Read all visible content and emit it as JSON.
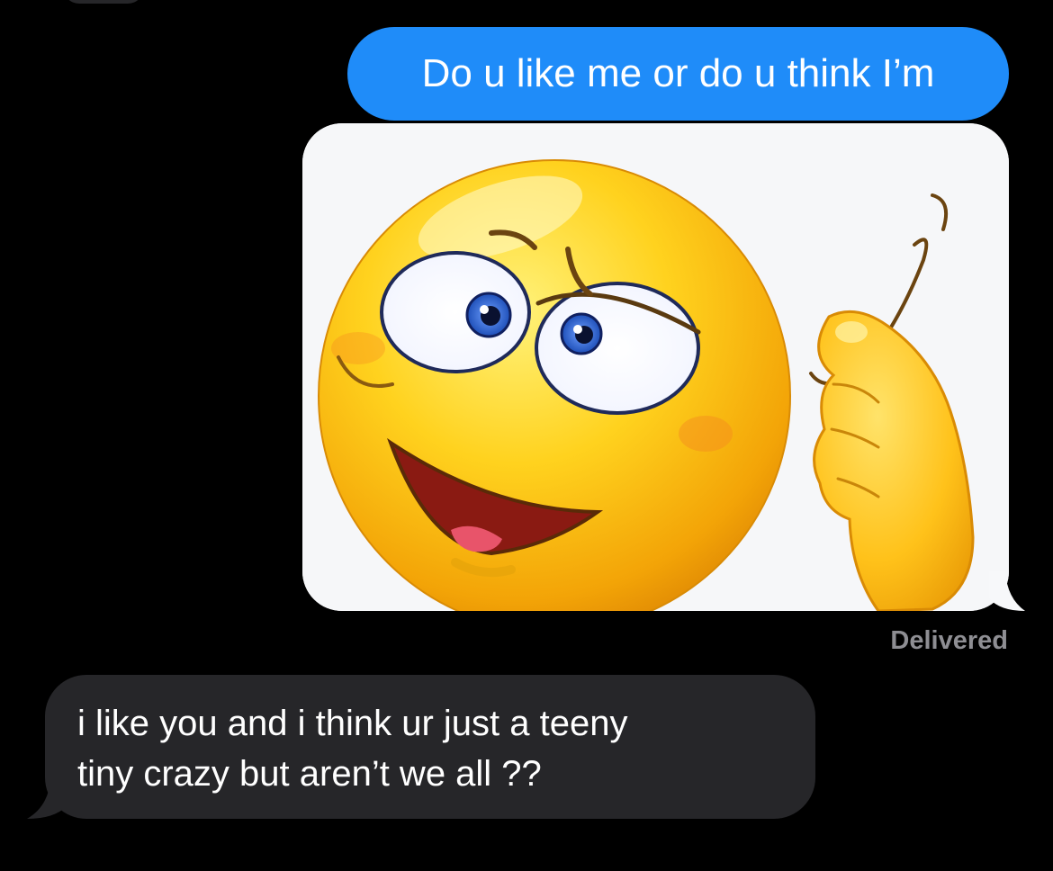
{
  "conversation": {
    "outgoing_text": "Do u like me or do u think I’m",
    "attachment_icon": "crazy-face-emoji-icon",
    "delivery_status": "Delivered",
    "incoming_text_line1": "i like you and i think ur just a teeny",
    "incoming_text_line2": "tiny crazy but aren’t we all ??"
  },
  "colors": {
    "background": "#000000",
    "outgoing_bubble": "#1f8cf9",
    "incoming_bubble": "#262629",
    "status_text": "#8e8e93"
  }
}
